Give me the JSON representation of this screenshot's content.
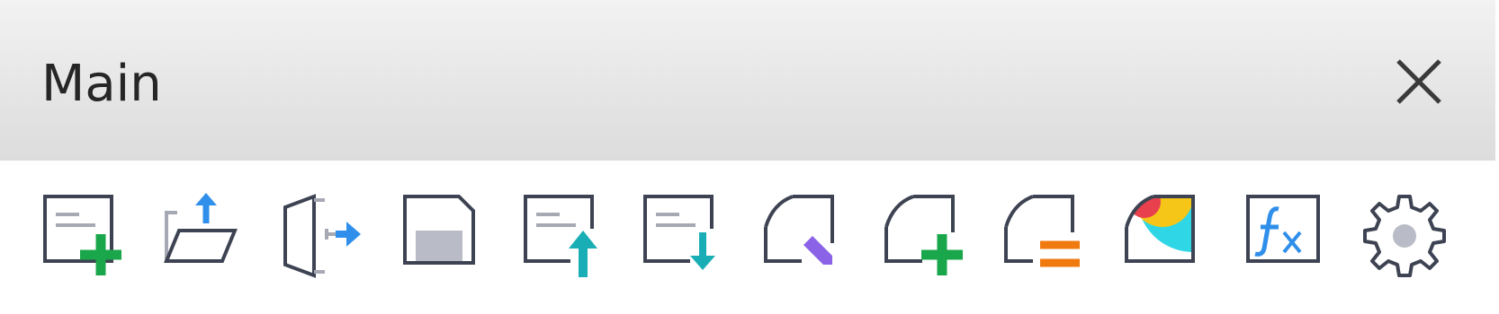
{
  "window": {
    "title": "Main",
    "close_icon": "close-icon"
  },
  "toolbar": {
    "tools": [
      {
        "name": "new-document-button",
        "icon": "new-document-icon"
      },
      {
        "name": "open-folder-button",
        "icon": "open-folder-icon"
      },
      {
        "name": "exit-button",
        "icon": "exit-icon"
      },
      {
        "name": "save-button",
        "icon": "save-icon"
      },
      {
        "name": "export-up-button",
        "icon": "document-upload-icon"
      },
      {
        "name": "import-down-button",
        "icon": "document-download-icon"
      },
      {
        "name": "edit-sheet-button",
        "icon": "edit-sheet-icon"
      },
      {
        "name": "add-sheet-button",
        "icon": "add-sheet-icon"
      },
      {
        "name": "equal-sheet-button",
        "icon": "equal-sheet-icon"
      },
      {
        "name": "color-theme-button",
        "icon": "color-sheet-icon"
      },
      {
        "name": "formula-button",
        "icon": "formula-fx-icon"
      },
      {
        "name": "settings-button",
        "icon": "gear-icon"
      }
    ]
  },
  "colors": {
    "outline": "#3d4352",
    "line": "#a6a9b3",
    "green": "#1aa64a",
    "blue": "#2f8fea",
    "teal": "#19aeb5",
    "purple": "#8a63e6",
    "orange": "#f07a10",
    "cyan": "#2fd6e6",
    "yellow": "#f5c518",
    "red": "#e8414d",
    "gray_fill": "#b9bcc6"
  }
}
